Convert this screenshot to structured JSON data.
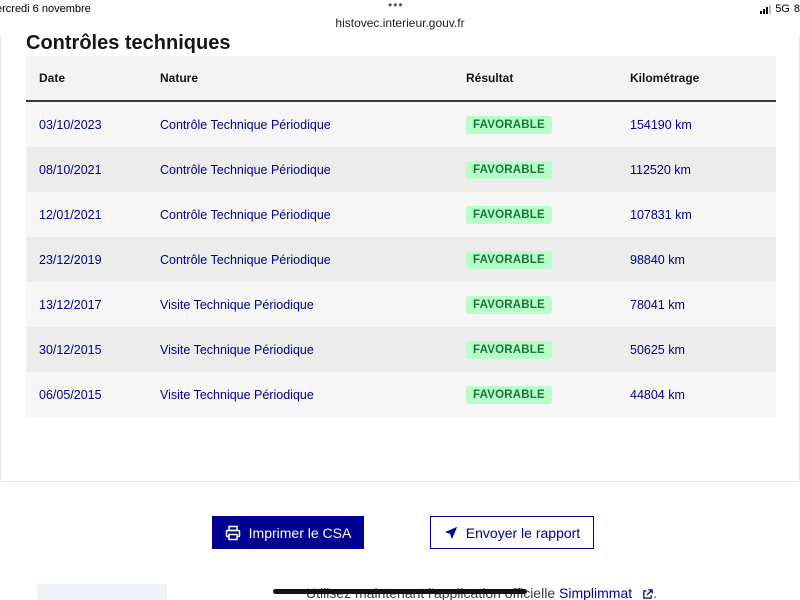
{
  "status_bar": {
    "date": "ercredi 6 novembre",
    "dots": "•••",
    "network": "5G",
    "battery": "8"
  },
  "browser": {
    "url": "histovec.interieur.gouv.fr"
  },
  "section": {
    "title": "Contrôles techniques"
  },
  "table": {
    "headers": {
      "date": "Date",
      "nature": "Nature",
      "result": "Résultat",
      "km": "Kilométrage"
    },
    "rows": [
      {
        "date": "03/10/2023",
        "nature": "Contrôle Technique Périodique",
        "result": "FAVORABLE",
        "km": "154190 km"
      },
      {
        "date": "08/10/2021",
        "nature": "Contrôle Technique Périodique",
        "result": "FAVORABLE",
        "km": "112520 km"
      },
      {
        "date": "12/01/2021",
        "nature": "Contrôle Technique Périodique",
        "result": "FAVORABLE",
        "km": "107831 km"
      },
      {
        "date": "23/12/2019",
        "nature": "Contrôle Technique Périodique",
        "result": "FAVORABLE",
        "km": "98840 km"
      },
      {
        "date": "13/12/2017",
        "nature": "Visite Technique Périodique",
        "result": "FAVORABLE",
        "km": "78041 km"
      },
      {
        "date": "30/12/2015",
        "nature": "Visite Technique Périodique",
        "result": "FAVORABLE",
        "km": "50625 km"
      },
      {
        "date": "06/05/2015",
        "nature": "Visite Technique Périodique",
        "result": "FAVORABLE",
        "km": "44804 km"
      }
    ]
  },
  "actions": {
    "print_label": "Imprimer le CSA",
    "send_label": "Envoyer le rapport",
    "print_icon": "printer-icon",
    "send_icon": "send-icon"
  },
  "promo": {
    "text": "Utilisez maintenant l'application officielle ",
    "link": "Simplimmat",
    "suffix": "."
  },
  "colors": {
    "primary": "#000091",
    "badge_bg": "#b8fec9",
    "badge_text": "#18753c",
    "header_bg": "#f3f3f3"
  }
}
